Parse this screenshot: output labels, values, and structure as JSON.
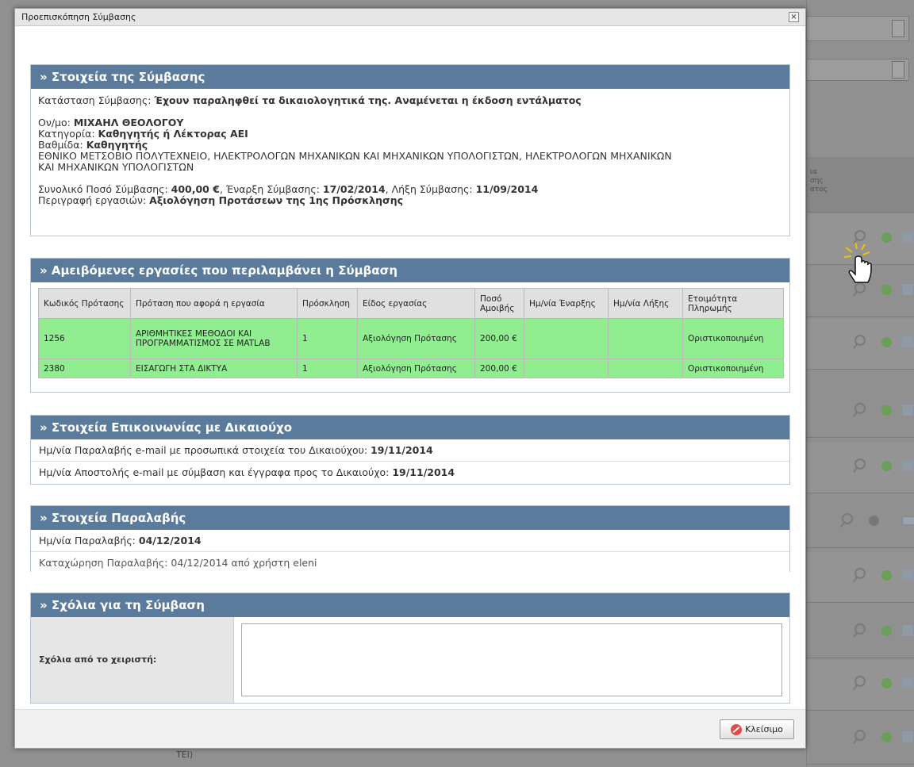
{
  "dialog": {
    "title": "Προεπισκόπηση Σύμβασης",
    "close_glyph": "×"
  },
  "contract": {
    "heading": "» Στοιχεία της Σύμβασης",
    "status_label": "Κατάσταση Σύμβασης: ",
    "status_value": "Έχουν παραληφθεί τα δικαιολογητικά της. Αναμένεται η έκδοση εντάλματος",
    "name_label": "Ον/μο: ",
    "name_value": "ΜΙΧΑΗΛ ΘΕΟΛΟΓΟΥ",
    "category_label": "Κατηγορία: ",
    "category_value": "Καθηγητής ή Λέκτορας ΑΕΙ",
    "rank_label": "Βαθμίδα: ",
    "rank_value": "Καθηγητής",
    "institution_line1": "ΕΘΝΙΚΟ ΜΕΤΣΟΒΙΟ ΠΟΛΥΤΕΧΝΕΙΟ, ΗΛΕΚΤΡΟΛΟΓΩΝ ΜΗΧΑΝΙΚΩΝ ΚΑΙ ΜΗΧΑΝΙΚΩΝ ΥΠΟΛΟΓΙΣΤΩΝ, ΗΛΕΚΤΡΟΛΟΓΩΝ ΜΗΧΑΝΙΚΩΝ",
    "institution_line2": "ΚΑΙ ΜΗΧΑΝΙΚΩΝ ΥΠΟΛΟΓΙΣΤΩΝ",
    "amount_label": "Συνολικό Ποσό Σύμβασης: ",
    "amount_value": "400,00 €",
    "start_label": ", Έναρξη Σύμβασης: ",
    "start_value": "17/02/2014",
    "end_label": ", Λήξη Σύμβασης: ",
    "end_value": "11/09/2014",
    "desc_label": "Περιγραφή εργασιών: ",
    "desc_value": "Αξιολόγηση Προτάσεων της 1ης Πρόσκλησης"
  },
  "works": {
    "heading": "» Αμειβόμενες εργασίες που περιλαμβάνει η Σύμβαση",
    "columns": [
      "Κωδικός Πρότασης",
      "Πρόταση που αφορά η εργασία",
      "Πρόσκληση",
      "Είδος εργασίας",
      "Ποσό Αμοιβής",
      "Ημ/νία Έναρξης",
      "Ημ/νία Λήξης",
      "Ετοιμότητα Πληρωμής"
    ],
    "rows": [
      [
        "1256",
        "ΑΡΙΘΜΗΤΙΚΕΣ ΜΕΘΟΔΟΙ ΚΑΙ ΠΡΟΓΡΑΜΜΑΤΙΣΜΟΣ ΣΕ MATLAB",
        "1",
        "Αξιολόγηση Πρότασης",
        "200,00 €",
        "",
        "",
        "Οριστικοποιημένη"
      ],
      [
        "2380",
        "ΕΙΣΑΓΩΓΗ ΣΤΑ ΔΙΚΤΥΑ",
        "1",
        "Αξιολόγηση Πρότασης",
        "200,00 €",
        "",
        "",
        "Οριστικοποιημένη"
      ]
    ]
  },
  "contact": {
    "heading": "» Στοιχεία Επικοινωνίας με Δικαιούχο",
    "received_label": "Ημ/νία Παραλαβής e-mail με προσωπικά στοιχεία του Δικαιούχου: ",
    "received_value": "19/11/2014",
    "sent_label": "Ημ/νία Αποστολής e-mail με σύμβαση και έγγραφα προς το Δικαιούχο: ",
    "sent_value": "19/11/2014"
  },
  "receipt": {
    "heading": "» Στοιχεία Παραλαβής",
    "date_label": "Ημ/νία Παραλαβής: ",
    "date_value": "04/12/2014",
    "registration": "Καταχώρηση Παραλαβής: 04/12/2014 από χρήστη eleni"
  },
  "comments": {
    "heading": "» Σχόλια για τη Σύμβαση",
    "label": "Σχόλια από το χειριστή:",
    "value": ""
  },
  "footer": {
    "close_label": "Κλείσιμο"
  },
  "background": {
    "col_header": "ια\nσης\nατος",
    "footer_text": "ΤΕΙ)"
  }
}
